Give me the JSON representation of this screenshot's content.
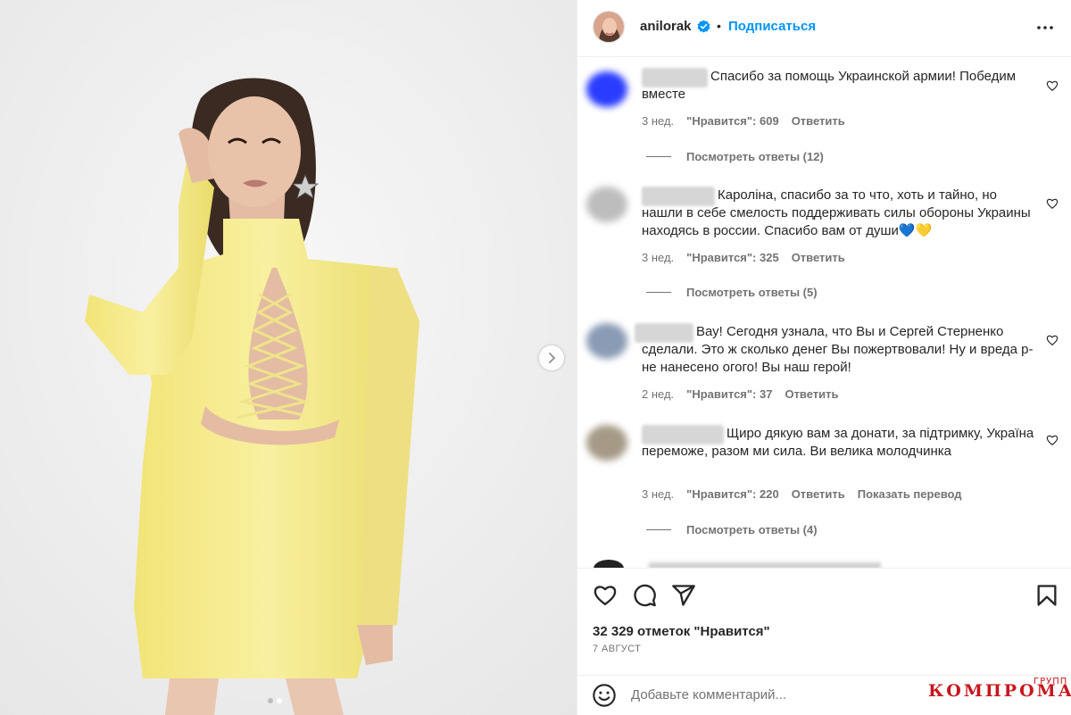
{
  "post": {
    "username": "anilorak",
    "follow_label": "Подписаться",
    "separator": "•",
    "likes_total": "32 329 отметок \"Нравится\"",
    "date": "7 АВГУСТ",
    "add_comment_placeholder": "Добавьте комментарий...",
    "photo_count": 2,
    "photo_active_index": 1
  },
  "comments": [
    {
      "text": "Спасибо за помощь Украинской армии! Победим вместе",
      "age": "3 нед.",
      "likes": "\"Нравится\": 609",
      "reply": "Ответить",
      "view_replies": "Посмотреть ответы (12)",
      "avatar_color": "#2a3cff"
    },
    {
      "text": "Кароліна, спасибо за то что, хоть и тайно, но нашли в себе смелость поддерживать силы обороны Украины находясь в россии. Спасибо вам от души💙💛",
      "age": "3 нед.",
      "likes": "\"Нравится\": 325",
      "reply": "Ответить",
      "view_replies": "Посмотреть ответы (5)",
      "avatar_color": "#bdbdbd"
    },
    {
      "text": "Вау! Сегодня узнала, что Вы и Сергей Стерненко сделали. Это ж сколько денег Вы пожертвовали! Ну и вреда р-не нанесено огого! Вы наш герой!",
      "age": "2 нед.",
      "likes": "\"Нравится\": 37",
      "reply": "Ответить",
      "avatar_color": "#8a9bb5"
    },
    {
      "text": "Щиро дякую вам за донати, за підтримку, Україна переможе, разом ми сила. Ви велика молодчинка",
      "age": "3 нед.",
      "likes": "\"Нравится\": 220",
      "reply": "Ответить",
      "translate": "Показать перевод",
      "view_replies": "Посмотреть ответы (4)",
      "avatar_color": "#a59a86"
    }
  ],
  "watermark": {
    "main": "КОМПРОМАТ",
    "sub": "ГРУПП"
  },
  "colors": {
    "accent": "#0095f6",
    "text": "#262626",
    "secondary": "#737373",
    "dress": "#f5ec8c",
    "watermark": "#c8161d"
  },
  "icons": [
    "chevron-right-icon",
    "verified-badge-icon",
    "more-icon",
    "heart-icon",
    "comment-icon",
    "share-icon",
    "bookmark-icon",
    "emoji-icon"
  ]
}
